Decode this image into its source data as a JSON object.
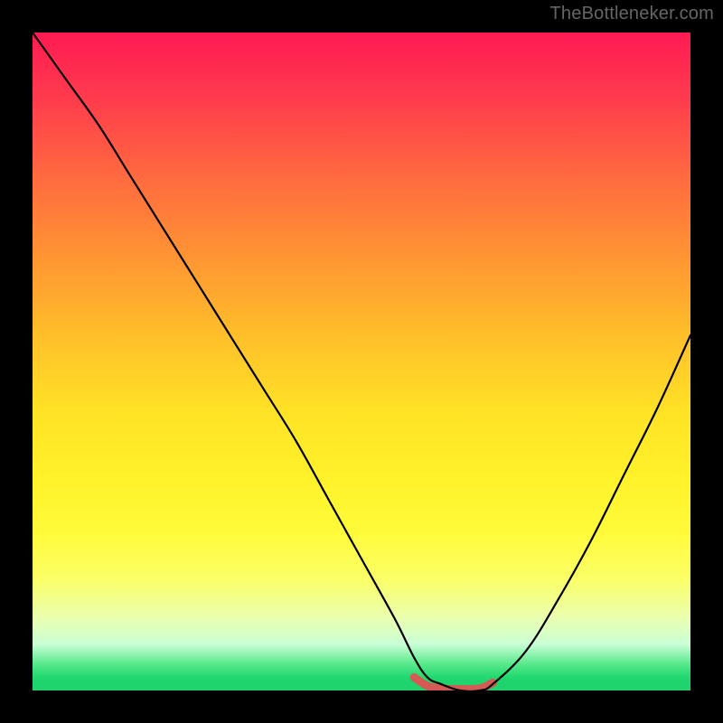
{
  "attribution": "TheBottleneker.com",
  "colors": {
    "frame": "#000000",
    "curve": "#000000",
    "highlight": "#d55a54",
    "gradient_top": "#ff1a53",
    "gradient_bottom": "#1fd46d"
  },
  "chart_data": {
    "type": "line",
    "title": "",
    "xlabel": "",
    "ylabel": "",
    "xlim": [
      0,
      100
    ],
    "ylim": [
      0,
      100
    ],
    "series": [
      {
        "name": "bottleneck-curve",
        "x": [
          0,
          5,
          10,
          15,
          20,
          25,
          30,
          35,
          40,
          45,
          50,
          55,
          58,
          60,
          62,
          65,
          68,
          70,
          75,
          80,
          85,
          90,
          95,
          100
        ],
        "y": [
          100,
          93,
          86,
          78,
          70,
          62,
          54,
          46,
          38,
          29,
          20,
          11,
          5,
          2,
          1,
          0,
          0,
          1,
          6,
          14,
          23,
          33,
          43,
          54
        ]
      },
      {
        "name": "optimal-range-highlight",
        "x": [
          58,
          60,
          62,
          65,
          68,
          70
        ],
        "y": [
          2,
          0.7,
          0.3,
          0.2,
          0.3,
          1.2
        ]
      }
    ],
    "notes": "V-shaped bottleneck curve over a vertical red→green gradient. The salmon highlight near the trough marks the optimal hardware match range. No axis ticks, labels, or legend are rendered in the image."
  }
}
